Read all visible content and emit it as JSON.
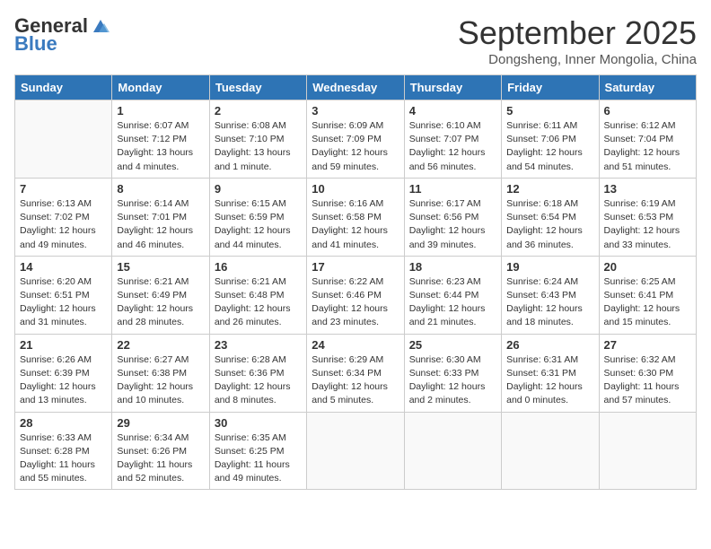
{
  "logo": {
    "general": "General",
    "blue": "Blue"
  },
  "header": {
    "title": "September 2025",
    "subtitle": "Dongsheng, Inner Mongolia, China"
  },
  "days_of_week": [
    "Sunday",
    "Monday",
    "Tuesday",
    "Wednesday",
    "Thursday",
    "Friday",
    "Saturday"
  ],
  "weeks": [
    [
      {
        "day": "",
        "info": ""
      },
      {
        "day": "1",
        "info": "Sunrise: 6:07 AM\nSunset: 7:12 PM\nDaylight: 13 hours\nand 4 minutes."
      },
      {
        "day": "2",
        "info": "Sunrise: 6:08 AM\nSunset: 7:10 PM\nDaylight: 13 hours\nand 1 minute."
      },
      {
        "day": "3",
        "info": "Sunrise: 6:09 AM\nSunset: 7:09 PM\nDaylight: 12 hours\nand 59 minutes."
      },
      {
        "day": "4",
        "info": "Sunrise: 6:10 AM\nSunset: 7:07 PM\nDaylight: 12 hours\nand 56 minutes."
      },
      {
        "day": "5",
        "info": "Sunrise: 6:11 AM\nSunset: 7:06 PM\nDaylight: 12 hours\nand 54 minutes."
      },
      {
        "day": "6",
        "info": "Sunrise: 6:12 AM\nSunset: 7:04 PM\nDaylight: 12 hours\nand 51 minutes."
      }
    ],
    [
      {
        "day": "7",
        "info": "Sunrise: 6:13 AM\nSunset: 7:02 PM\nDaylight: 12 hours\nand 49 minutes."
      },
      {
        "day": "8",
        "info": "Sunrise: 6:14 AM\nSunset: 7:01 PM\nDaylight: 12 hours\nand 46 minutes."
      },
      {
        "day": "9",
        "info": "Sunrise: 6:15 AM\nSunset: 6:59 PM\nDaylight: 12 hours\nand 44 minutes."
      },
      {
        "day": "10",
        "info": "Sunrise: 6:16 AM\nSunset: 6:58 PM\nDaylight: 12 hours\nand 41 minutes."
      },
      {
        "day": "11",
        "info": "Sunrise: 6:17 AM\nSunset: 6:56 PM\nDaylight: 12 hours\nand 39 minutes."
      },
      {
        "day": "12",
        "info": "Sunrise: 6:18 AM\nSunset: 6:54 PM\nDaylight: 12 hours\nand 36 minutes."
      },
      {
        "day": "13",
        "info": "Sunrise: 6:19 AM\nSunset: 6:53 PM\nDaylight: 12 hours\nand 33 minutes."
      }
    ],
    [
      {
        "day": "14",
        "info": "Sunrise: 6:20 AM\nSunset: 6:51 PM\nDaylight: 12 hours\nand 31 minutes."
      },
      {
        "day": "15",
        "info": "Sunrise: 6:21 AM\nSunset: 6:49 PM\nDaylight: 12 hours\nand 28 minutes."
      },
      {
        "day": "16",
        "info": "Sunrise: 6:21 AM\nSunset: 6:48 PM\nDaylight: 12 hours\nand 26 minutes."
      },
      {
        "day": "17",
        "info": "Sunrise: 6:22 AM\nSunset: 6:46 PM\nDaylight: 12 hours\nand 23 minutes."
      },
      {
        "day": "18",
        "info": "Sunrise: 6:23 AM\nSunset: 6:44 PM\nDaylight: 12 hours\nand 21 minutes."
      },
      {
        "day": "19",
        "info": "Sunrise: 6:24 AM\nSunset: 6:43 PM\nDaylight: 12 hours\nand 18 minutes."
      },
      {
        "day": "20",
        "info": "Sunrise: 6:25 AM\nSunset: 6:41 PM\nDaylight: 12 hours\nand 15 minutes."
      }
    ],
    [
      {
        "day": "21",
        "info": "Sunrise: 6:26 AM\nSunset: 6:39 PM\nDaylight: 12 hours\nand 13 minutes."
      },
      {
        "day": "22",
        "info": "Sunrise: 6:27 AM\nSunset: 6:38 PM\nDaylight: 12 hours\nand 10 minutes."
      },
      {
        "day": "23",
        "info": "Sunrise: 6:28 AM\nSunset: 6:36 PM\nDaylight: 12 hours\nand 8 minutes."
      },
      {
        "day": "24",
        "info": "Sunrise: 6:29 AM\nSunset: 6:34 PM\nDaylight: 12 hours\nand 5 minutes."
      },
      {
        "day": "25",
        "info": "Sunrise: 6:30 AM\nSunset: 6:33 PM\nDaylight: 12 hours\nand 2 minutes."
      },
      {
        "day": "26",
        "info": "Sunrise: 6:31 AM\nSunset: 6:31 PM\nDaylight: 12 hours\nand 0 minutes."
      },
      {
        "day": "27",
        "info": "Sunrise: 6:32 AM\nSunset: 6:30 PM\nDaylight: 11 hours\nand 57 minutes."
      }
    ],
    [
      {
        "day": "28",
        "info": "Sunrise: 6:33 AM\nSunset: 6:28 PM\nDaylight: 11 hours\nand 55 minutes."
      },
      {
        "day": "29",
        "info": "Sunrise: 6:34 AM\nSunset: 6:26 PM\nDaylight: 11 hours\nand 52 minutes."
      },
      {
        "day": "30",
        "info": "Sunrise: 6:35 AM\nSunset: 6:25 PM\nDaylight: 11 hours\nand 49 minutes."
      },
      {
        "day": "",
        "info": ""
      },
      {
        "day": "",
        "info": ""
      },
      {
        "day": "",
        "info": ""
      },
      {
        "day": "",
        "info": ""
      }
    ]
  ]
}
